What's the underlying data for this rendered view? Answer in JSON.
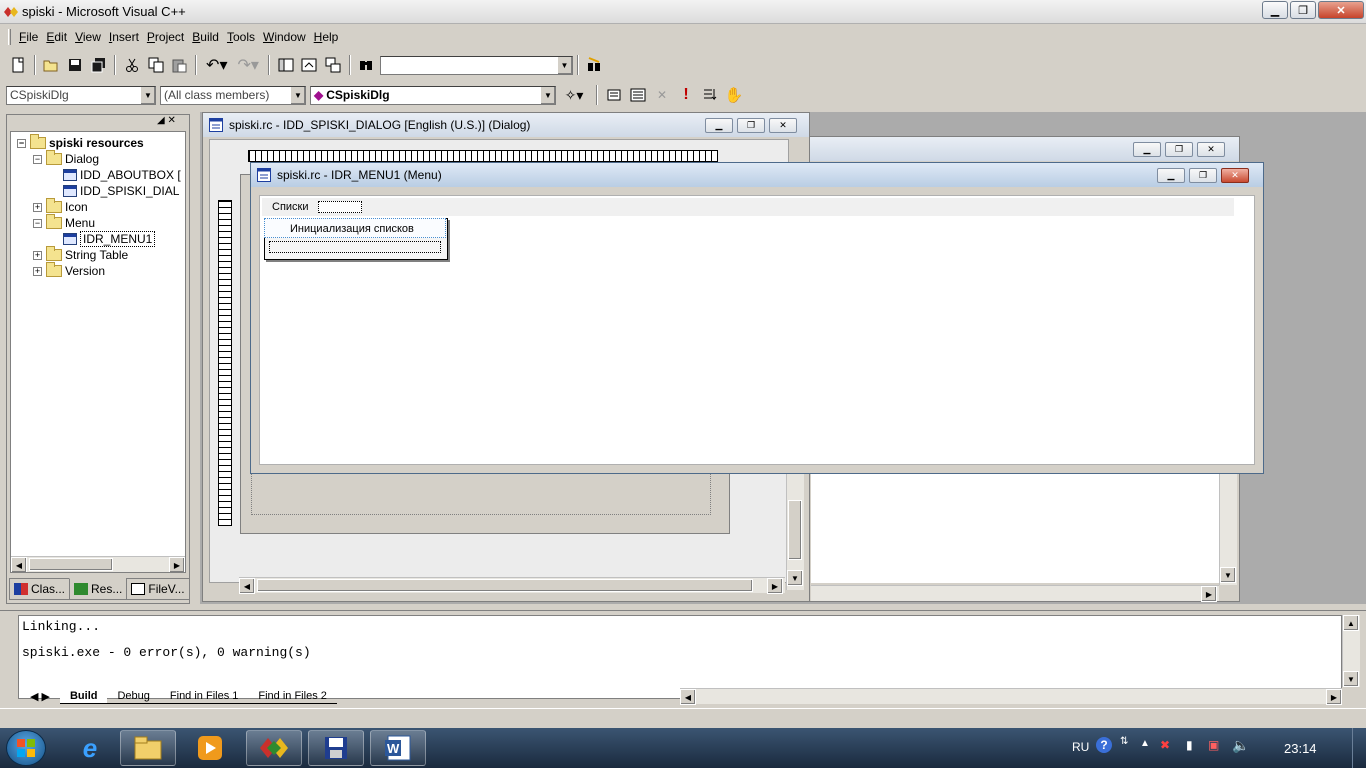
{
  "window": {
    "title": "spiski - Microsoft Visual C++"
  },
  "menubar": [
    "File",
    "Edit",
    "View",
    "Insert",
    "Project",
    "Build",
    "Tools",
    "Window",
    "Help"
  ],
  "toolbar": {
    "find_combo_value": "",
    "class_combo": "CSpiskiDlg",
    "members_combo": "(All class members)",
    "function_combo": "CSpiskiDlg"
  },
  "workspace": {
    "tree": [
      {
        "label": "spiski resources",
        "bold": true
      },
      {
        "label": "Dialog"
      },
      {
        "label": "IDD_ABOUTBOX ["
      },
      {
        "label": "IDD_SPISKI_DIAL"
      },
      {
        "label": "Icon"
      },
      {
        "label": "Menu"
      },
      {
        "label": "IDR_MENU1"
      },
      {
        "label": "String Table"
      },
      {
        "label": "Version"
      }
    ],
    "tabs": [
      "Clas...",
      "Res...",
      "FileV..."
    ]
  },
  "documents": {
    "dialog_window": {
      "title": "spiski.rc - IDD_SPISKI_DIALOG [English (U.S.)] (Dialog)"
    },
    "menu_window": {
      "title": "spiski.rc - IDR_MENU1 (Menu)",
      "menu_top": "Списки",
      "menu_item": "Инициализация списков"
    }
  },
  "output": {
    "lines": [
      "Linking...",
      "spiski.exe - 0 error(s), 0 warning(s)"
    ],
    "tabs": [
      "Build",
      "Debug",
      "Find in Files 1",
      "Find in Files 2"
    ]
  },
  "taskbar": {
    "language": "RU",
    "clock": "23:14"
  }
}
